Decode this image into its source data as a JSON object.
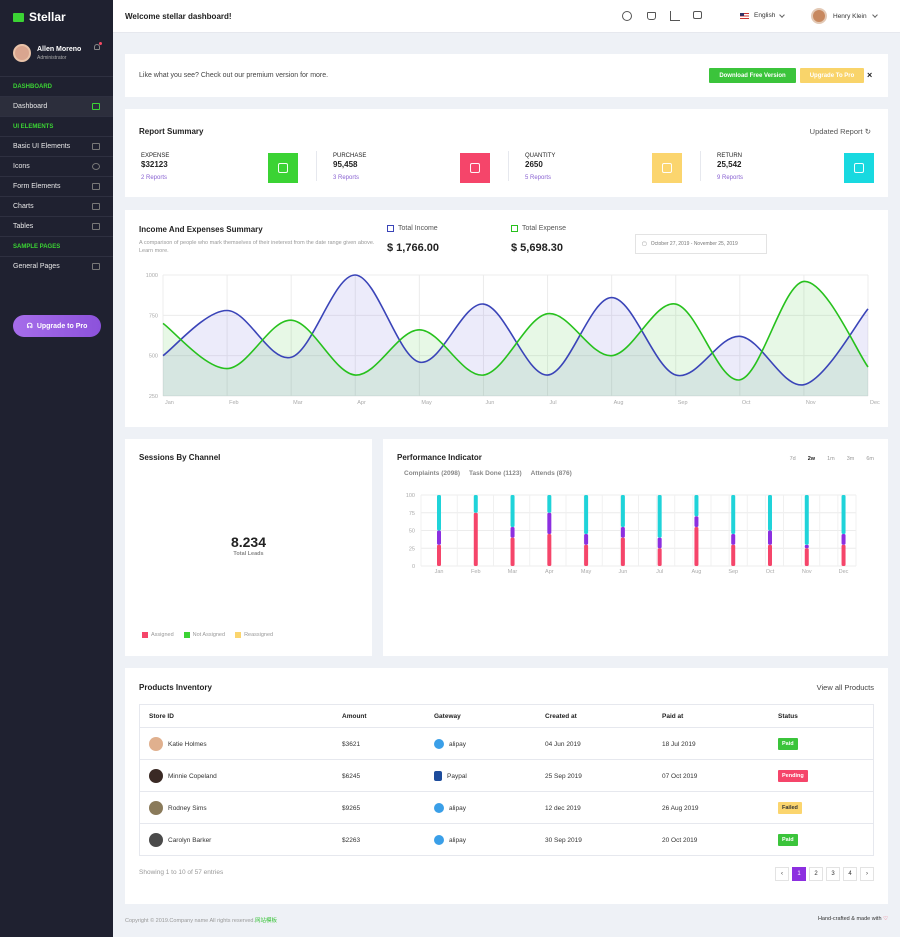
{
  "sidebar": {
    "brand": "Stellar",
    "profile": {
      "name": "Allen Moreno",
      "role": "Administrator"
    },
    "sections": [
      {
        "title": "DASHBOARD",
        "items": [
          "Dashboard"
        ]
      },
      {
        "title": "UI ELEMENTS",
        "items": [
          "Basic UI Elements",
          "Icons",
          "Form Elements",
          "Charts",
          "Tables"
        ]
      },
      {
        "title": "SAMPLE PAGES",
        "items": [
          "General Pages"
        ]
      }
    ],
    "upgrade_label": "Upgrade to Pro"
  },
  "topbar": {
    "welcome": "Welcome stellar dashboard!",
    "language": "English",
    "user": "Henry Klein"
  },
  "banner": {
    "text": "Like what you see? Check out our premium version for more.",
    "download": "Download Free Version",
    "upgrade": "Upgrade To Pro",
    "close": "×"
  },
  "report": {
    "title": "Report Summary",
    "updated": "Updated Report",
    "stats": [
      {
        "label": "EXPENSE",
        "value": "$32123",
        "reports": "2 Reports",
        "color": "#3bd334"
      },
      {
        "label": "PURCHASE",
        "value": "95,458",
        "reports": "3 Reports",
        "color": "#f5456a"
      },
      {
        "label": "QUANTITY",
        "value": "2650",
        "reports": "5 Reports",
        "color": "#fbd56e"
      },
      {
        "label": "RETURN",
        "value": "25,542",
        "reports": "9 Reports",
        "color": "#18d9e0"
      }
    ]
  },
  "income": {
    "title": "Income And Expenses Summary",
    "subtitle": "A comparison of people who mark themselves of their ineterest from the date range given above. Learn more.",
    "income_label": "Total Income",
    "income_value": "$ 1,766.00",
    "expense_label": "Total Expense",
    "expense_value": "$ 5,698.30",
    "date_range": "October 27, 2019 - November 25, 2019"
  },
  "sessions": {
    "title": "Sessions By Channel",
    "value": "8.234",
    "caption": "Total Leads",
    "legend": [
      "Assigned",
      "Not Assigned",
      "Reassigned"
    ]
  },
  "performance": {
    "title": "Performance Indicator",
    "ranges": [
      "7d",
      "2w",
      "1m",
      "3m",
      "6m"
    ],
    "tabs": [
      "Complaints (2098)",
      "Task Done (1123)",
      "Attends (876)"
    ]
  },
  "inventory": {
    "title": "Products Inventory",
    "view_all": "View all Products",
    "headers": [
      "Store ID",
      "Amount",
      "Gateway",
      "Created at",
      "Paid at",
      "Status"
    ],
    "rows": [
      {
        "name": "Katie Holmes",
        "amount": "$3621",
        "gateway": "alipay",
        "created": "04 Jun 2019",
        "paid": "18 Jul 2019",
        "status": "Paid"
      },
      {
        "name": "Minnie Copeland",
        "amount": "$6245",
        "gateway": "Paypal",
        "created": "25 Sep 2019",
        "paid": "07 Oct 2019",
        "status": "Pending"
      },
      {
        "name": "Rodney Sims",
        "amount": "$9265",
        "gateway": "alipay",
        "created": "12 dec 2019",
        "paid": "26 Aug 2019",
        "status": "Failed"
      },
      {
        "name": "Carolyn Barker",
        "amount": "$2263",
        "gateway": "alipay",
        "created": "30 Sep 2019",
        "paid": "20 Oct 2019",
        "status": "Paid"
      }
    ],
    "showing": "Showing 1 to 10 of 57 entries",
    "pages": [
      "‹",
      "1",
      "2",
      "3",
      "4",
      "›"
    ]
  },
  "footer": {
    "left": "Copyright © 2019.Company name All rights reserved.",
    "left_link": "网站模板",
    "right": "Hand-crafted & made with",
    "heart": "♡"
  },
  "chart_data": [
    {
      "type": "area",
      "categories": [
        "Jan",
        "Feb",
        "Mar",
        "Apr",
        "May",
        "Jun",
        "Jul",
        "Aug",
        "Sep",
        "Oct",
        "Nov",
        "Dec"
      ],
      "ylim": [
        250,
        1000
      ],
      "yticks": [
        1000,
        750,
        500,
        250
      ],
      "series": [
        {
          "name": "Total Income",
          "color": "#3a44b8",
          "values": [
            500,
            780,
            490,
            1000,
            460,
            820,
            380,
            860,
            380,
            620,
            320,
            790
          ]
        },
        {
          "name": "Total Expense",
          "color": "#27c11d",
          "values": [
            700,
            420,
            720,
            380,
            660,
            380,
            760,
            500,
            820,
            350,
            960,
            430
          ]
        }
      ]
    },
    {
      "type": "bar",
      "categories": [
        "Jan",
        "Feb",
        "Mar",
        "Apr",
        "May",
        "Jun",
        "Jul",
        "Aug",
        "Sep",
        "Oct",
        "Nov",
        "Dec"
      ],
      "ylim": [
        0,
        100
      ],
      "yticks": [
        100,
        75,
        50,
        25,
        0
      ],
      "stacked": true,
      "series": [
        {
          "name": "Complaints",
          "color": "#f5456a",
          "values": [
            30,
            75,
            40,
            45,
            30,
            40,
            25,
            55,
            30,
            30,
            25,
            30
          ]
        },
        {
          "name": "Task Done",
          "color": "#8c2fe0",
          "values": [
            20,
            0,
            15,
            30,
            15,
            15,
            15,
            15,
            15,
            20,
            5,
            15
          ]
        },
        {
          "name": "Attends",
          "color": "#1fd3d9",
          "values": [
            50,
            25,
            45,
            25,
            55,
            45,
            60,
            30,
            55,
            50,
            70,
            55
          ]
        }
      ]
    }
  ]
}
